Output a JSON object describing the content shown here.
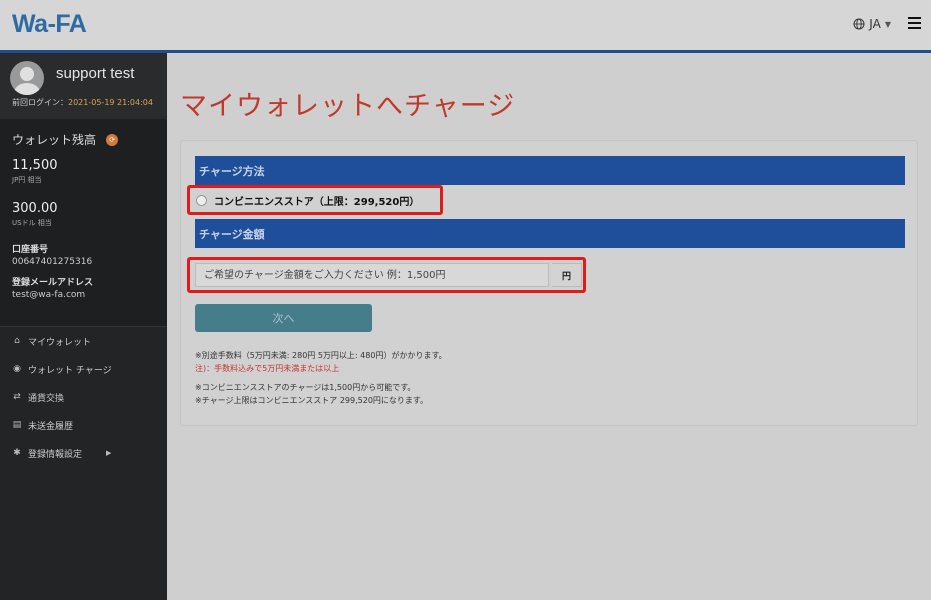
{
  "header": {
    "logo": "Wa-FA",
    "language": "JA",
    "colors": {
      "accent_line": "#1f4e8c"
    }
  },
  "sidebar": {
    "username": "support test",
    "last_login_label": "前回ログイン：",
    "last_login_value": "2021-05-19 21:04:04",
    "wallet_title": "ウォレット残高",
    "balances": [
      {
        "amount": "11,500",
        "unit": "JP円 相当"
      },
      {
        "amount": "300.00",
        "unit": "USドル 相当"
      }
    ],
    "account_label": "口座番号",
    "account_value": "00647401275316",
    "email_label": "登録メールアドレス",
    "email_value": "test@wa-fa.com",
    "menu": [
      {
        "icon": "bank-icon",
        "label": "マイウォレット"
      },
      {
        "icon": "money-bag-icon",
        "label": "ウォレット チャージ"
      },
      {
        "icon": "exchange-icon",
        "label": "通貨交換"
      },
      {
        "icon": "history-icon",
        "label": "未送金履歴"
      },
      {
        "icon": "gear-icon",
        "label": "登録情報設定"
      }
    ]
  },
  "main": {
    "title": "マイウォレットへチャージ",
    "section_method": "チャージ方法",
    "method_option": "コンビニエンスストア（上限：299,520円）",
    "section_amount": "チャージ金額",
    "amount_placeholder": "ご希望のチャージ金額をご入力ください 例：1,500円",
    "amount_value": "",
    "currency": "円",
    "next_button": "次へ",
    "note1": "※別途手数料（5万円未満: 280円 5万円以上: 480円）がかかります。",
    "note2": "注)：手数料込みで5万円未満または以上",
    "note3": "※コンビニエンスストアのチャージは1,500円から可能です。",
    "note4": "※チャージ上限はコンビニエンスストア 299,520円になります。",
    "colors": {
      "title": "#c0392b",
      "section_bg": "#1f4e9b",
      "button": "#467d8b",
      "highlight": "#e01b1b"
    }
  }
}
